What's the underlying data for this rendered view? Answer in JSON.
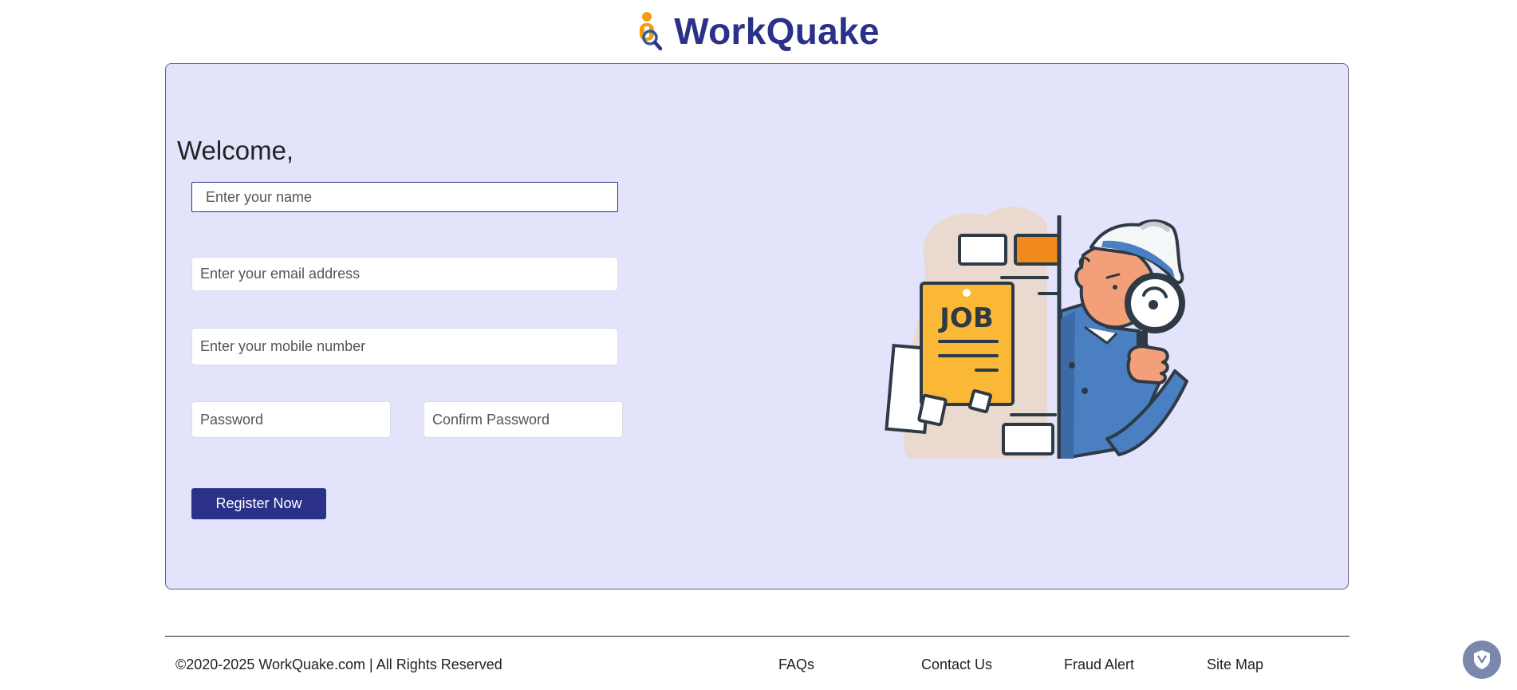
{
  "brand": {
    "name": "WorkQuake"
  },
  "welcome": "Welcome,",
  "form": {
    "name_placeholder": "Enter your name",
    "email_placeholder": "Enter your email address",
    "mobile_placeholder": "Enter your mobile number",
    "password_placeholder": "Password",
    "confirm_password_placeholder": "Confirm Password",
    "register_label": "Register Now"
  },
  "illustration": {
    "job_label": "JOB"
  },
  "footer": {
    "copyright": "©2020-2025 WorkQuake.com | All Rights Reserved",
    "links": [
      "FAQs",
      "Contact Us",
      "Fraud Alert",
      "Site Map"
    ]
  },
  "colors": {
    "brand": "#2b3088",
    "card_background": "#e3e4fb",
    "accent_orange": "#f08a1c",
    "job_yellow": "#fbb836",
    "detective_blue": "#4a7fc1"
  }
}
